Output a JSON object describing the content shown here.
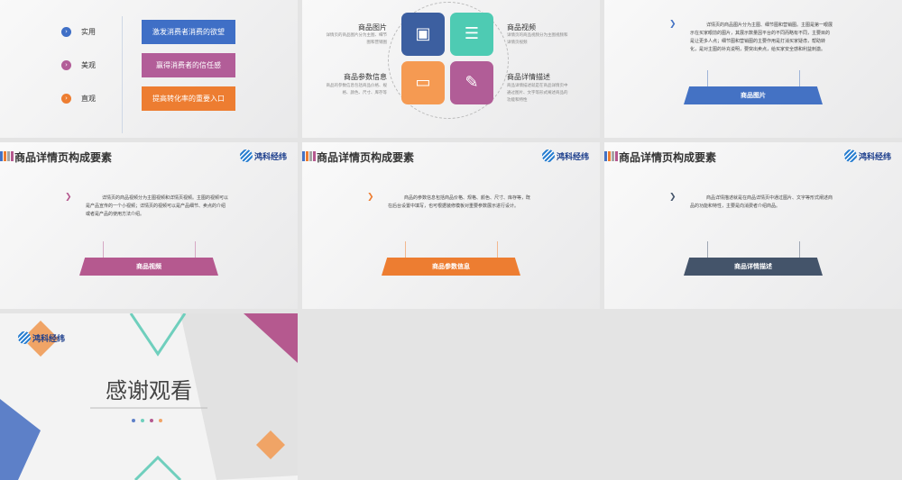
{
  "slide1": {
    "items": [
      {
        "label": "实用",
        "button": "激发消费者消费的欲望",
        "color": "#3f6fc6"
      },
      {
        "label": "美观",
        "button": "赢得消费者的信任感",
        "color": "#b25d98"
      },
      {
        "label": "直观",
        "button": "提高转化率的重要入口",
        "color": "#ed7d31"
      }
    ]
  },
  "slide2": {
    "blocks": [
      {
        "title": "商品图片",
        "desc": "详情页的商品图片分为主图、细节图和营销图"
      },
      {
        "title": "商品视频",
        "desc": "详情页的商品视频分为主图视频和详情页视频"
      },
      {
        "title": "商品参数信息",
        "desc": "商品的参数信息包括商品价格、规格、颜色、尺寸、库存等"
      },
      {
        "title": "商品详情描述",
        "desc": "商品详情描述就是在商品详情页中通过图片、文字等形式阐述商品的功能和特性"
      }
    ]
  },
  "header": {
    "title": "商品详情页构成要素",
    "logo": "鸿科经纬"
  },
  "detail_slides": [
    {
      "text": "详情页的商品图片分为主图、细节图和营销图。主图是第一眼展示在买家眼前的图片，其展示数量因平台的不同而略有不同，主要目的是让更多人点；细节图和营销图的主要作用是打消买家疑虑，帮助转化，是对主图的补充说明，要突出卖点，给买家安全感和利益刺激。",
      "label": "商品图片",
      "color": "#4472c4"
    },
    {
      "text": "详情页的商品视频分为主图视频和详情页视频。主图的视频可以是产品宣传的一个小视频；详情页的视频可以是产品细节、卖点的介绍或者是产品的使用方法介绍。",
      "label": "商品视频",
      "color": "#b5598f"
    },
    {
      "text": "商品的参数信息包括商品价格、规格、颜色、尺寸、库存等，既在后台设置中填写，也可根据装修模板对重要参数展示进行设计。",
      "label": "商品参数信息",
      "color": "#ed7d31"
    },
    {
      "text": "商品详情描述就是在商品详情页中通过图片、文字等形式阐述商品的功能和特性，主要是向消费者介绍商品。",
      "label": "商品详情描述",
      "color": "#44546a"
    }
  ],
  "end": {
    "title": "感谢观看",
    "logo": "鸿科经纬"
  }
}
